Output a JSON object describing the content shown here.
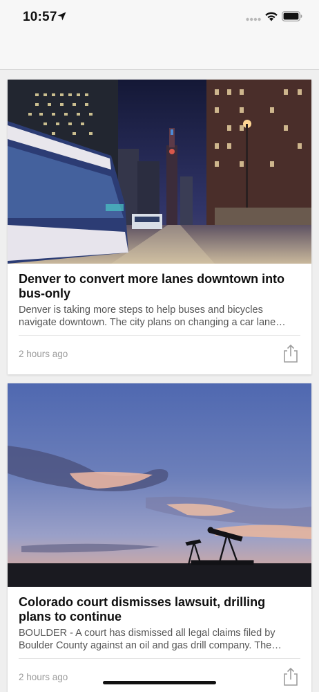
{
  "status_bar": {
    "time": "10:57",
    "icons": [
      "location-arrow-icon",
      "signal-dots-icon",
      "wifi-icon",
      "battery-icon"
    ]
  },
  "articles": [
    {
      "title": "Denver to convert more lanes downtown into bus-only",
      "summary": "Denver is taking more steps to help buses and bicycles navigate downtown. The city plans on changing a car lane…",
      "time_ago": "2 hours ago",
      "share_icon": "share-icon"
    },
    {
      "title": "Colorado court dismisses lawsuit, drilling plans to continue",
      "summary": "BOULDER - A court has dismissed all legal claims filed by Boulder County against an oil and gas drill company. The…",
      "time_ago": "2 hours ago",
      "share_icon": "share-icon"
    }
  ],
  "colors": {
    "background": "#efefef",
    "card": "#ffffff",
    "title": "#0e0e0e",
    "summary": "#555555",
    "timestamp": "#9a9a9a",
    "icon_gray": "#9c9c9c"
  }
}
